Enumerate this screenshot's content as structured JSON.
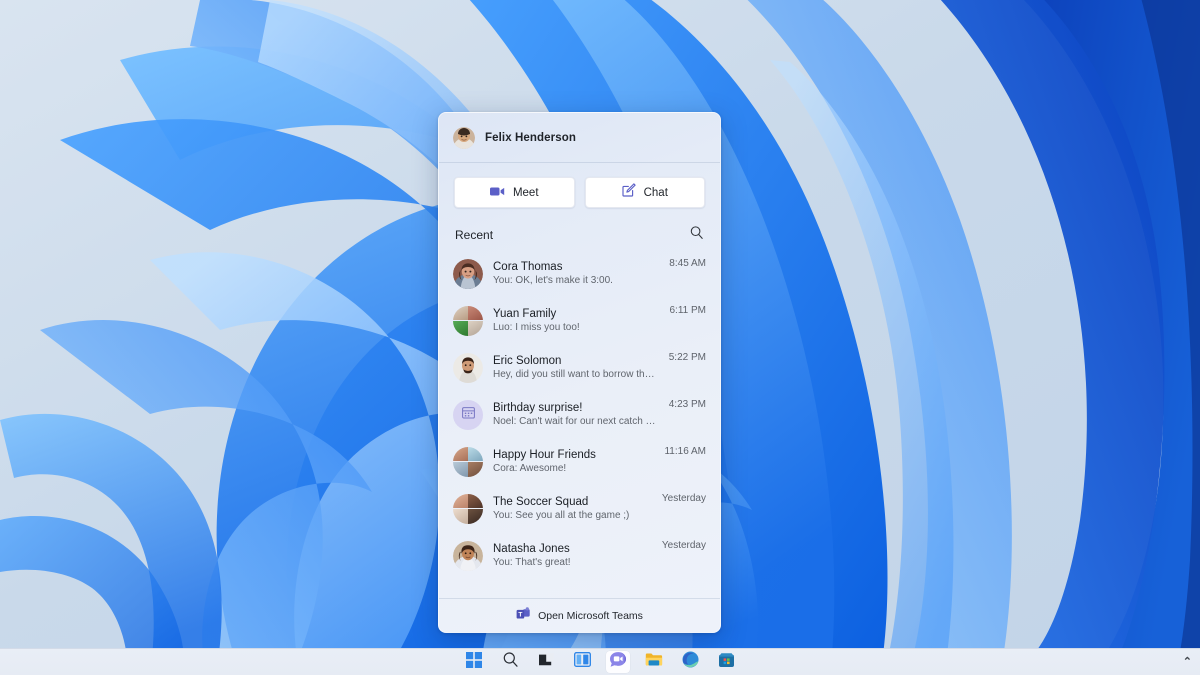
{
  "desktop": {
    "wallpaper_name": "windows-11-bloom-wallpaper",
    "background_color": "#cfdced",
    "accent_blue": "#1a7dff",
    "deep_blue": "#0a43c8"
  },
  "flyout": {
    "name": "microsoft-teams-chat-flyout",
    "header": {
      "user_name": "Felix Henderson",
      "avatar_name": "felix-henderson-avatar"
    },
    "actions": [
      {
        "label": "Meet",
        "icon": "video-camera-icon",
        "icon_color": "#5b5fc7"
      },
      {
        "label": "Chat",
        "icon": "compose-message-icon",
        "icon_color": "#5b5fc7"
      }
    ],
    "recent": {
      "label": "Recent",
      "search_icon": "search-icon"
    },
    "chats": [
      {
        "title": "Cora Thomas",
        "preview": "You: OK, let's make it 3:00.",
        "time": "8:45 AM",
        "avatar_type": "photo",
        "avatar_name": "cora-thomas-avatar",
        "avatar_colors": [
          "#8d5b4c",
          "#c98f78",
          "#6b7d93"
        ]
      },
      {
        "title": "Yuan Family",
        "preview": "Luo: I miss you too!",
        "time": "6:11 PM",
        "avatar_type": "mosaic",
        "avatar_name": "yuan-family-group-avatar",
        "avatar_colors": [
          "#c8b09a",
          "#b5766a",
          "#3f8f3f",
          "#cfc0b2"
        ]
      },
      {
        "title": "Eric Solomon",
        "preview": "Hey, did you still want to borrow the notes?",
        "time": "5:22 PM",
        "avatar_type": "photo",
        "avatar_name": "eric-solomon-avatar",
        "avatar_colors": [
          "#5a3a2c",
          "#d0a183",
          "#e8e6e2"
        ]
      },
      {
        "title": "Birthday surprise!",
        "preview": "Noel: Can't wait for our next catch up!",
        "time": "4:23 PM",
        "avatar_type": "icon",
        "avatar_name": "birthday-calendar-avatar",
        "avatar_bg": "#d7d4f2",
        "avatar_icon": "calendar-icon",
        "avatar_icon_color": "#7a78c4"
      },
      {
        "title": "Happy Hour Friends",
        "preview": "Cora: Awesome!",
        "time": "11:16 AM",
        "avatar_type": "mosaic",
        "avatar_name": "happy-hour-friends-group-avatar",
        "avatar_colors": [
          "#c08c74",
          "#a5ccd8",
          "#9fb7c9",
          "#8a6a58"
        ]
      },
      {
        "title": "The Soccer Squad",
        "preview": "You: See you all at the game ;)",
        "time": "Yesterday",
        "avatar_type": "mosaic",
        "avatar_name": "soccer-squad-group-avatar",
        "avatar_colors": [
          "#cf9f86",
          "#6b4a38",
          "#e2cdbc",
          "#4d3a2e"
        ]
      },
      {
        "title": "Natasha Jones",
        "preview": "You: That's great!",
        "time": "Yesterday",
        "avatar_type": "photo",
        "avatar_name": "natasha-jones-avatar",
        "avatar_colors": [
          "#6d4632",
          "#c08a6a",
          "#d8dce6"
        ]
      }
    ],
    "footer": {
      "label": "Open Microsoft Teams",
      "icon": "microsoft-teams-logo-icon",
      "icon_color": "#5b5fc7"
    }
  },
  "taskbar": {
    "background_color": "#e8edf5",
    "items": [
      {
        "name": "start-button",
        "icon": "windows-logo-icon",
        "label": "Start"
      },
      {
        "name": "search-button",
        "icon": "search-icon",
        "label": "Search"
      },
      {
        "name": "task-view-button",
        "icon": "task-view-icon",
        "label": "Task View"
      },
      {
        "name": "widgets-button",
        "icon": "widgets-icon",
        "label": "Widgets"
      },
      {
        "name": "chat-button",
        "icon": "teams-chat-icon",
        "label": "Chat",
        "active": true
      },
      {
        "name": "file-explorer-button",
        "icon": "file-explorer-icon",
        "label": "File Explorer"
      },
      {
        "name": "edge-button",
        "icon": "microsoft-edge-icon",
        "label": "Microsoft Edge"
      },
      {
        "name": "store-button",
        "icon": "microsoft-store-icon",
        "label": "Microsoft Store"
      }
    ],
    "tray": {
      "show_hidden_icons": "hidden-icons-chevron-icon",
      "chevron": "⌃"
    }
  }
}
